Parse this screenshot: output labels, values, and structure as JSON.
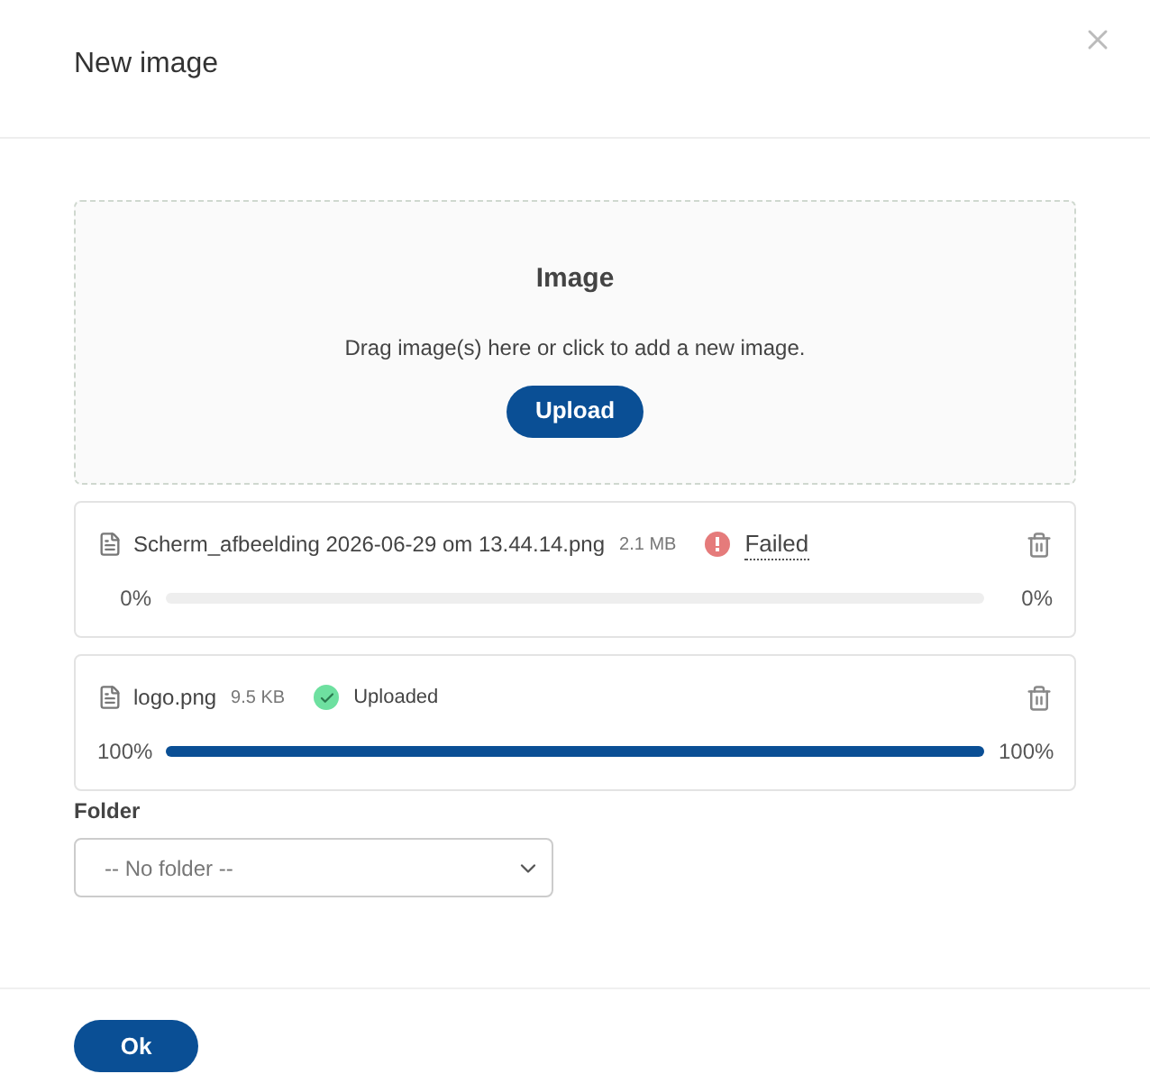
{
  "dialog": {
    "title": "New image"
  },
  "dropzone": {
    "title": "Image",
    "hint": "Drag image(s) here or click to add a new image.",
    "button": "Upload"
  },
  "files": [
    {
      "name": "Scherm_afbeelding 2026-06-29 om 13.44.14.png",
      "size": "2.1 MB",
      "status": {
        "kind": "failed",
        "label": "Failed"
      },
      "level": 0,
      "percent_start": "0%",
      "percent_end": "0%"
    },
    {
      "name": "logo.png",
      "size": "9.5 KB",
      "status": {
        "kind": "uploaded",
        "label": "Uploaded"
      },
      "level": 1,
      "percent_start": "100%",
      "percent_end": "100%"
    }
  ],
  "folder": {
    "label": "Folder",
    "value": "-- No folder --"
  },
  "footer": {
    "button": "Ok"
  }
}
